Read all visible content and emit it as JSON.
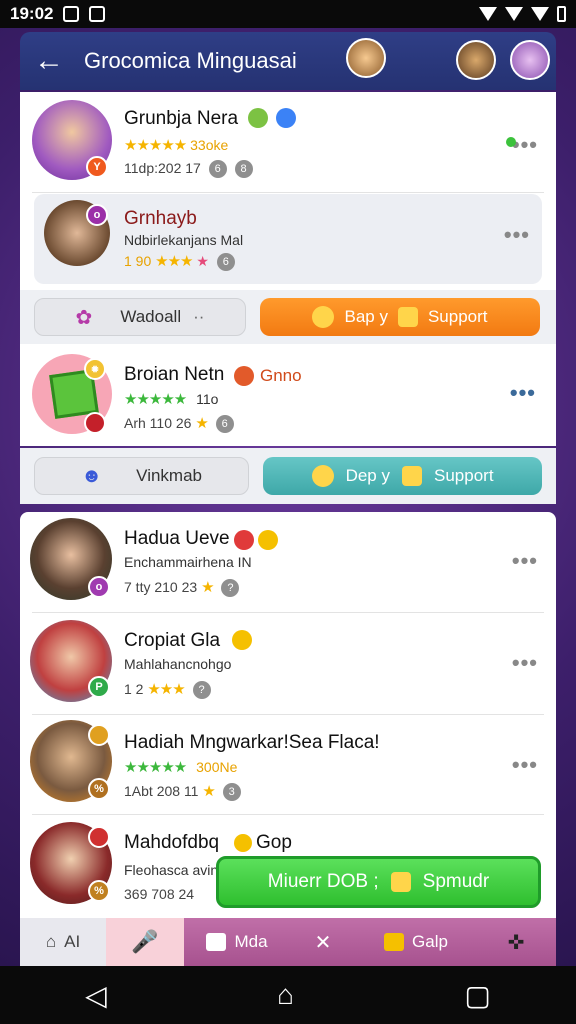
{
  "status_bar": {
    "time": "19:02"
  },
  "header": {
    "title": "Grocomica Minguasai"
  },
  "card1": {
    "name": "Grunbja Nera",
    "rating_text": "33oke",
    "meta": "11dp:202 17"
  },
  "card2": {
    "name": "Grnhayb",
    "sub": "Ndbirlekanjans Mal",
    "meta": "1 90"
  },
  "actions1": {
    "left_label": "Wadoall",
    "orange_label": "Bap y",
    "support_label": "Support"
  },
  "card3": {
    "name": "Broian Netn",
    "tag": "Gnno",
    "rating_text": "11o",
    "meta": "Arh 110 26"
  },
  "actions2": {
    "left_label": "Vinkmab",
    "teal_label": "Dep y",
    "support_label": "Support"
  },
  "list": [
    {
      "name": "Hadua Ueve",
      "sub": "Enchammairhena IN",
      "meta": "7 tty 210 23"
    },
    {
      "name": "Cropiat Gla",
      "sub": "Mahlahancnohgo",
      "meta": "1 2"
    },
    {
      "name": "Hadiah Mngwarkar!Sea Flaca!",
      "rating_text": "300Ne",
      "meta": "1Abt 208 11"
    },
    {
      "name": "Mahdofdbq",
      "tag": "Gop",
      "sub": "Fleohasca avin",
      "meta": "369 708 24"
    }
  ],
  "fab": {
    "label": "Miuerr DOB ;",
    "support_label": "Spmudr"
  },
  "bottom_nav": {
    "home_label": "AI",
    "item3_label": "Mda",
    "item5_label": "Galp"
  },
  "colors": {
    "accent": "#f27a12",
    "teal": "#3ea8a8",
    "green": "#2fbf2f",
    "header": "#2f3e86"
  }
}
